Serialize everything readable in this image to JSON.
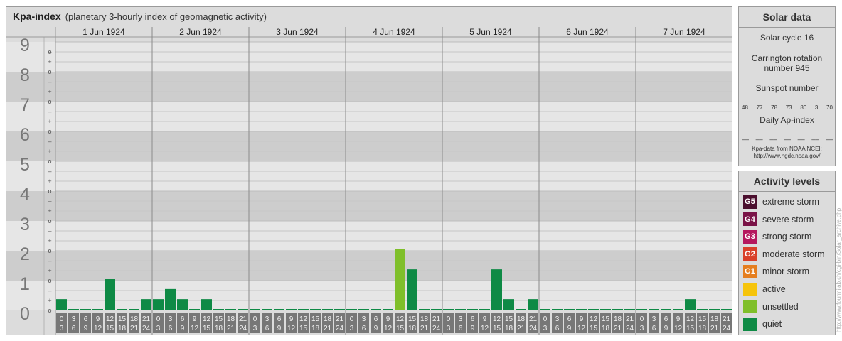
{
  "header": {
    "title": "Kpa-index",
    "subtitle": "(planetary 3-hourly index of geomagnetic activity)"
  },
  "chart_data": {
    "type": "bar",
    "title": "Kpa-index",
    "subtitle": "(planetary 3-hourly index of geomagnetic activity)",
    "ylim": [
      0,
      9
    ],
    "y_ticks": [
      "0",
      "1",
      "2",
      "3",
      "4",
      "5",
      "6",
      "7",
      "8",
      "9"
    ],
    "sub_ticks": [
      "o",
      "+",
      "–"
    ],
    "days": [
      "1 Jun 1924",
      "2 Jun 1924",
      "3 Jun 1924",
      "4 Jun 1924",
      "5 Jun 1924",
      "6 Jun 1924",
      "7 Jun 1924"
    ],
    "interval_labels": [
      [
        "0",
        "3"
      ],
      [
        "3",
        "6"
      ],
      [
        "6",
        "9"
      ],
      [
        "9",
        "12"
      ],
      [
        "12",
        "15"
      ],
      [
        "15",
        "18"
      ],
      [
        "18",
        "21"
      ],
      [
        "21",
        "24"
      ]
    ],
    "values": [
      [
        0.33,
        0,
        0,
        0,
        1,
        0,
        0,
        0.33
      ],
      [
        0.33,
        0.67,
        0.33,
        0,
        0.33,
        0,
        0,
        0
      ],
      [
        0,
        0,
        0,
        0,
        0,
        0,
        0,
        0
      ],
      [
        0,
        0,
        0,
        0,
        2,
        1.33,
        0,
        0
      ],
      [
        0,
        0,
        0,
        0,
        1.33,
        0.33,
        0,
        0.33
      ],
      [
        0,
        0,
        0,
        0,
        0,
        0,
        0,
        0
      ],
      [
        0,
        0,
        0,
        0,
        0.33,
        0,
        0,
        0
      ]
    ],
    "grid": true
  },
  "solar": {
    "heading": "Solar data",
    "cycle": "Solar cycle 16",
    "carrington_line1": "Carrington rotation",
    "carrington_line2": "number 945",
    "sunspot_label": "Sunspot number",
    "sunspot_values": [
      "48",
      "77",
      "78",
      "73",
      "80",
      "3",
      "70"
    ],
    "ap_label": "Daily Ap-index",
    "ap_values": [
      "––",
      "––",
      "––",
      "––",
      "––",
      "––",
      "––"
    ],
    "credit_line1": "Kpa-data from NOAA NCEI:",
    "credit_line2": "http://www.ngdc.noaa.gov/"
  },
  "levels": {
    "heading": "Activity levels",
    "items": [
      {
        "badge": "G5",
        "label": "extreme storm",
        "color": "#4b0f2e"
      },
      {
        "badge": "G4",
        "label": "severe storm",
        "color": "#7a1347"
      },
      {
        "badge": "G3",
        "label": "strong storm",
        "color": "#b5175e"
      },
      {
        "badge": "G2",
        "label": "moderate storm",
        "color": "#d9402a"
      },
      {
        "badge": "G1",
        "label": "minor storm",
        "color": "#e57e1f"
      },
      {
        "badge": "",
        "label": "active",
        "color": "#f6c40b"
      },
      {
        "badge": "",
        "label": "unsettled",
        "color": "#7fbf2a"
      },
      {
        "badge": "",
        "label": "quiet",
        "color": "#0e8a45"
      }
    ]
  },
  "watermark": "http://www.fourmilab.ch/cgi-bin/Solar_archive.php"
}
